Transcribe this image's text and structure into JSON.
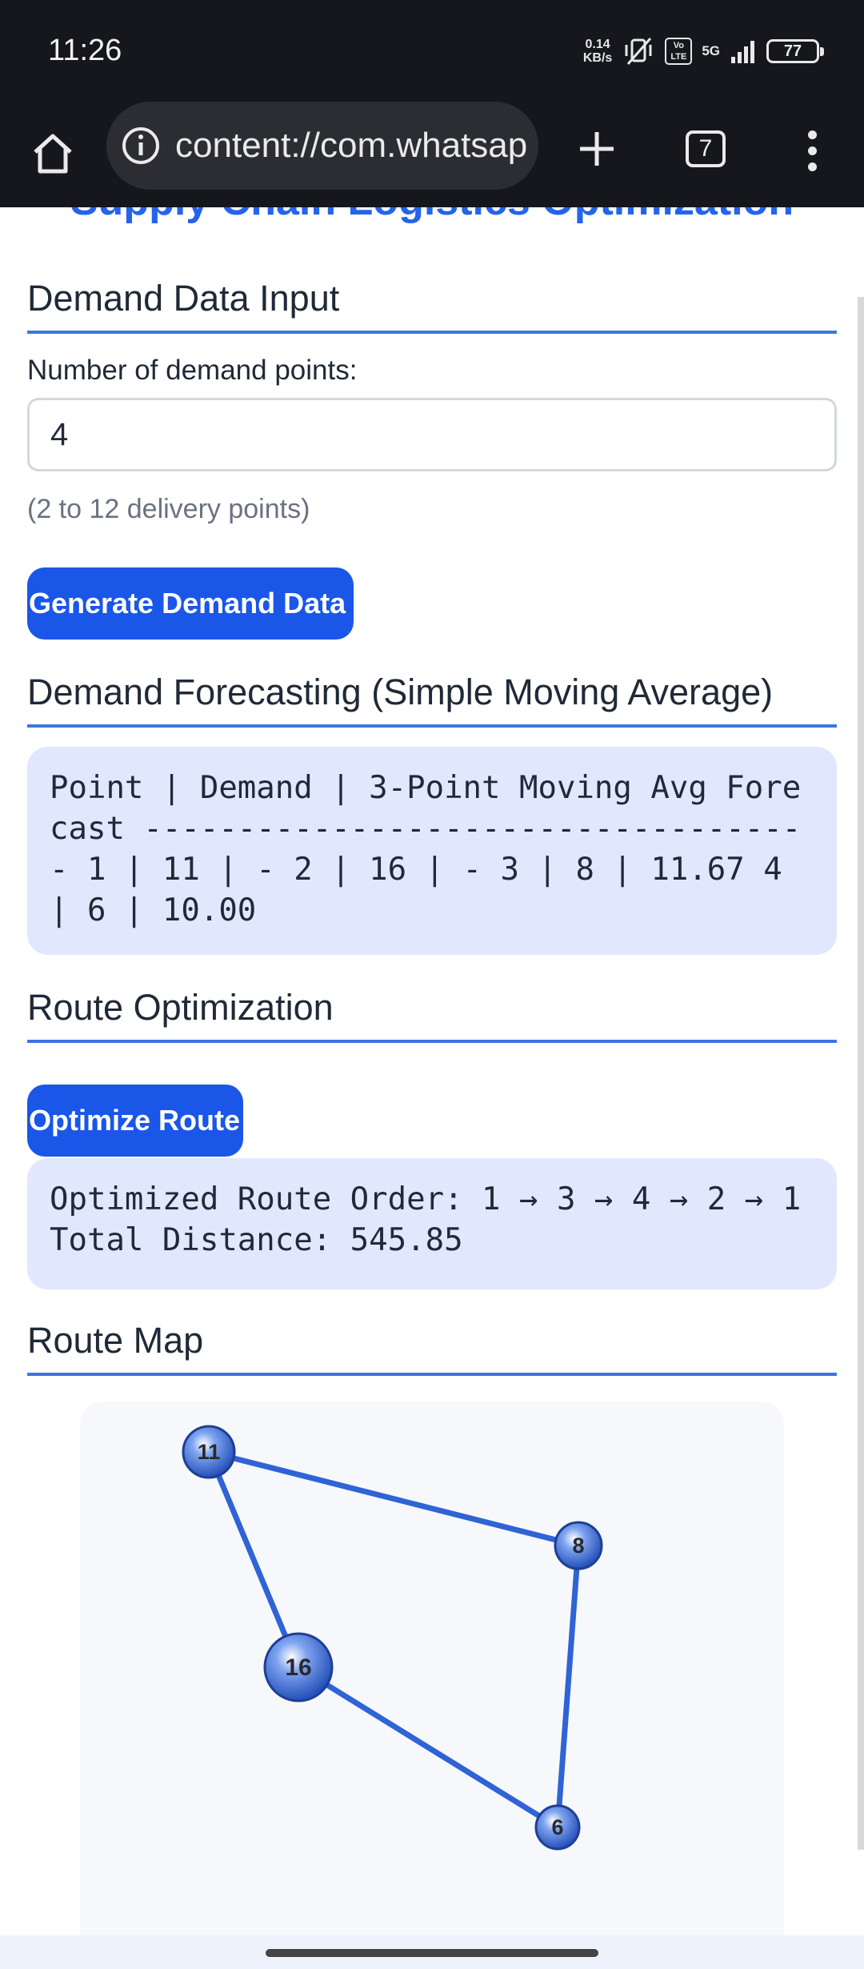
{
  "status_bar": {
    "time": "11:26",
    "net_speed_value": "0.14",
    "net_speed_unit": "KB/s",
    "volte": "Vo LTE",
    "network": "5G",
    "battery": "77"
  },
  "browser": {
    "url": "content://com.whatsapp",
    "tab_count": "7"
  },
  "page": {
    "title": "Supply Chain Logistics Optimization",
    "demand_input": {
      "heading": "Demand Data Input",
      "points_label": "Number of demand points:",
      "points_value": "4",
      "hint": "(2 to 12 delivery points)",
      "generate_button": "Generate Demand Data"
    },
    "forecast": {
      "heading": "Demand Forecasting (Simple Moving Average)",
      "output": "Point | Demand | 3-Point Moving Avg Forecast ------------------------------------ 1 | 11 | - 2 | 16 | - 3 | 8 | 11.67 4 | 6 | 10.00"
    },
    "route": {
      "heading": "Route Optimization",
      "optimize_button": "Optimize Route",
      "output": "Optimized Route Order: 1 → 3 → 4 → 2 → 1 Total Distance: 545.85"
    },
    "map": {
      "heading": "Route Map",
      "accent": "#2f63d6",
      "nodes": [
        {
          "label": "11"
        },
        {
          "label": "8"
        },
        {
          "label": "16"
        },
        {
          "label": "6"
        }
      ]
    }
  }
}
